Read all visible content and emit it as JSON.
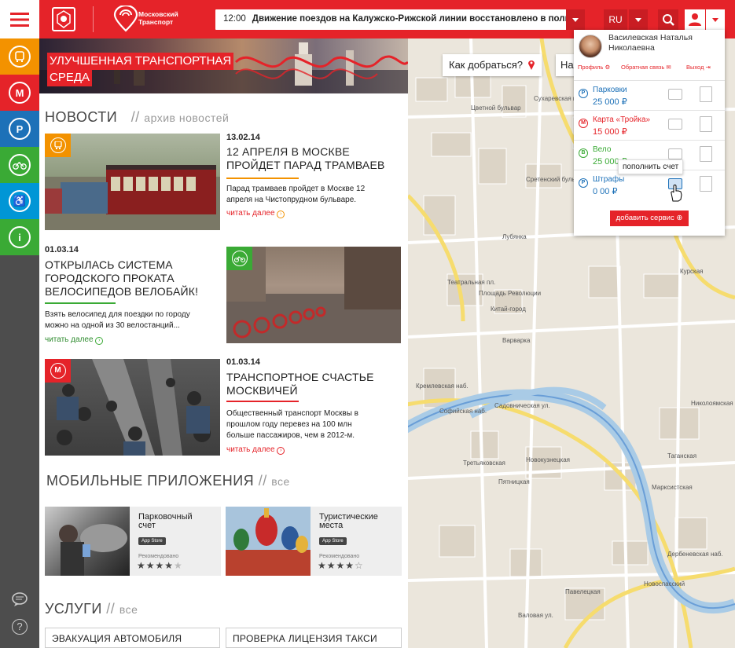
{
  "colors": {
    "brand_red": "#e52329",
    "bus": "#f39200",
    "metro": "#e52329",
    "parking": "#1d71b8",
    "bike": "#3aaa35",
    "access": "#0096d6",
    "info": "#3aaa35"
  },
  "sidebar": {
    "items": [
      {
        "icon": "bus-icon",
        "label": "bus"
      },
      {
        "icon": "metro-icon",
        "label": "М"
      },
      {
        "icon": "parking-icon",
        "label": "P"
      },
      {
        "icon": "bike-icon",
        "label": "bike"
      },
      {
        "icon": "accessibility-icon",
        "label": "♿"
      },
      {
        "icon": "info-icon",
        "label": "i"
      }
    ]
  },
  "header": {
    "logo_text": "Московский Транспорт",
    "ticker_time": "12:00",
    "ticker_text": "Движение поездов на Калужско-Рижской линии восстановлено в полном объеме",
    "lang": "RU"
  },
  "banner": {
    "title_line1": "УЛУЧШЕННАЯ ТРАНСПОРТНАЯ",
    "title_line2": "СРЕДА"
  },
  "news": {
    "heading": "НОВОСТИ",
    "archive_sep": "//",
    "archive": "архив новостей",
    "items": [
      {
        "date": "13.02.14",
        "title": "12 АПРЕЛЯ В МОСКВЕ ПРОЙДЕТ ПАРАД ТРАМВАЕВ",
        "desc": "Парад трамваев пройдет в Москве 12 апреля на Чистопрудном бульваре.",
        "more": "читать далее"
      },
      {
        "date": "01.03.14",
        "title": "ОТКРЫЛАСЬ СИСТЕМА ГОРОДСКОГО ПРОКАТА ВЕЛОСИПЕДОВ ВЕЛОБАЙК!",
        "desc": "Взять велосипед для поездки по городу можно на одной из 30 велостанций...",
        "more": "читать далее"
      },
      {
        "date": "01.03.14",
        "title": "ТРАНСПОРТНОЕ СЧАСТЬЕ МОСКВИЧЕЙ",
        "desc": "Общественный транспорт Москвы в прошлом году перевез на 100 млн больше пассажиров, чем в 2012-м.",
        "more": "читать далее"
      }
    ]
  },
  "apps": {
    "heading": "МОБИЛЬНЫЕ ПРИЛОЖЕНИЯ",
    "sep": "//",
    "all": "все",
    "items": [
      {
        "name": "Парковочный счет",
        "store": "App Store",
        "rec": "Рекомендовано",
        "rating": 4
      },
      {
        "name": "Туристические места",
        "store": "App Store",
        "rec": "Рекомендовано",
        "rating": 4.5
      }
    ]
  },
  "services": {
    "heading": "УСЛУГИ",
    "sep": "//",
    "all": "все",
    "items": [
      "ЭВАКУАЦИЯ АВТОМОБИЛЯ",
      "ПРОВЕРКА ЛИЦЕНЗИЯ ТАКСИ"
    ]
  },
  "map": {
    "route_placeholder": "Как добраться?",
    "route_tab2": "На",
    "streets": [
      "Сухаревская пл.",
      "Цветной бульвар",
      "Сретенский бульвар",
      "Лубянка",
      "Театральная пл.",
      "Площадь Революции",
      "Китай-город",
      "Варварка",
      "Софийская наб.",
      "Садовническая ул.",
      "Новокузнецкая",
      "Третьяковская",
      "Пятницкая",
      "Таганская",
      "Марксистская",
      "Курская",
      "Ул. Земляной Вал",
      "Николоямская",
      "Новоспасский",
      "Дербеневская наб.",
      "Павелецкая",
      "Валовая ул.",
      "Кремлевская наб.",
      "Садовая-Черногрязская"
    ]
  },
  "user_panel": {
    "name": "Василевская Наталья Николаевна",
    "profile": "Профиль",
    "feedback": "Обратная связь",
    "logout": "Выход",
    "services": [
      {
        "name": "Парковки",
        "value": "25 000 ₽",
        "icon": "P",
        "color": "#1d71b8"
      },
      {
        "name": "Карта «Тройка»",
        "value": "15 000 ₽",
        "icon": "М",
        "color": "#e52329"
      },
      {
        "name": "Вело",
        "value": "25 000 ₽",
        "icon": "В",
        "color": "#3aaa35"
      },
      {
        "name": "Штрафы",
        "value": "0 00 ₽",
        "icon": "P",
        "color": "#1d71b8"
      }
    ],
    "tooltip": "пополнить счет",
    "add_service": "добавить сервис"
  }
}
